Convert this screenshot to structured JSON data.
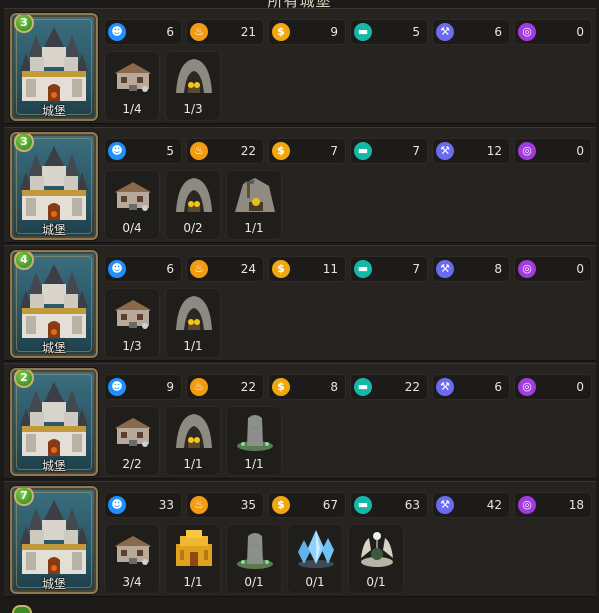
{
  "header": {
    "title": "所有城堡"
  },
  "resource_icons": [
    {
      "icon": "population-icon",
      "color": "#1e90ff",
      "glyph": "☻"
    },
    {
      "icon": "food-icon",
      "color": "#f39c12",
      "glyph": "♨"
    },
    {
      "icon": "gold-icon",
      "color": "#f1a80d",
      "glyph": "$"
    },
    {
      "icon": "stone-icon",
      "color": "#14b8a6",
      "glyph": "▬"
    },
    {
      "icon": "power-icon",
      "color": "#6b6bf0",
      "glyph": "⚒"
    },
    {
      "icon": "mana-icon",
      "color": "#a23be0",
      "glyph": "◎"
    }
  ],
  "castles": [
    {
      "level": "3",
      "label": "城堡",
      "resources": [
        "6",
        "21",
        "9",
        "5",
        "6",
        "0"
      ],
      "buildings": [
        {
          "type": "workshop",
          "count": "1/4"
        },
        {
          "type": "gold-mine",
          "count": "1/3"
        }
      ]
    },
    {
      "level": "3",
      "label": "城堡",
      "resources": [
        "5",
        "22",
        "7",
        "7",
        "12",
        "0"
      ],
      "buildings": [
        {
          "type": "workshop",
          "count": "0/4"
        },
        {
          "type": "gold-mine",
          "count": "0/2"
        },
        {
          "type": "stone-mine",
          "count": "1/1"
        }
      ]
    },
    {
      "level": "4",
      "label": "城堡",
      "resources": [
        "6",
        "24",
        "11",
        "7",
        "8",
        "0"
      ],
      "buildings": [
        {
          "type": "workshop",
          "count": "1/3"
        },
        {
          "type": "gold-mine",
          "count": "1/1"
        }
      ]
    },
    {
      "level": "2",
      "label": "城堡",
      "resources": [
        "9",
        "22",
        "8",
        "22",
        "6",
        "0"
      ],
      "buildings": [
        {
          "type": "workshop",
          "count": "2/2"
        },
        {
          "type": "gold-mine",
          "count": "1/1"
        },
        {
          "type": "monolith",
          "count": "1/1"
        }
      ]
    },
    {
      "level": "7",
      "label": "城堡",
      "resources": [
        "33",
        "35",
        "67",
        "63",
        "42",
        "18"
      ],
      "buildings": [
        {
          "type": "workshop",
          "count": "3/4"
        },
        {
          "type": "golden-temple",
          "count": "1/1"
        },
        {
          "type": "monolith",
          "count": "0/1"
        },
        {
          "type": "crystal",
          "count": "0/1"
        },
        {
          "type": "altar",
          "count": "0/1"
        }
      ]
    }
  ]
}
